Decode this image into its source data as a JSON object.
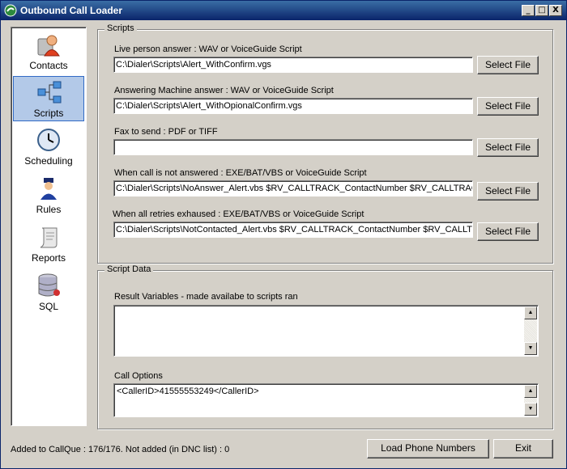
{
  "window": {
    "title": "Outbound Call Loader",
    "minimize_glyph": "_",
    "maximize_glyph": "□",
    "close_glyph": "X"
  },
  "nav": {
    "items": [
      {
        "label": "Contacts",
        "icon": "contacts-icon"
      },
      {
        "label": "Scripts",
        "icon": "scripts-icon",
        "selected": true
      },
      {
        "label": "Scheduling",
        "icon": "clock-icon"
      },
      {
        "label": "Rules",
        "icon": "police-officer-icon"
      },
      {
        "label": "Reports",
        "icon": "scroll-icon"
      },
      {
        "label": "SQL",
        "icon": "database-icon"
      }
    ]
  },
  "scripts": {
    "group_title": "Scripts",
    "select_label": "Select File",
    "fields": [
      {
        "label": "Live person answer : WAV or VoiceGuide Script",
        "value": "C:\\Dialer\\Scripts\\Alert_WithConfirm.vgs"
      },
      {
        "label": "Answering Machine answer : WAV or VoiceGuide Script",
        "value": "C:\\Dialer\\Scripts\\Alert_WithOpionalConfirm.vgs"
      },
      {
        "label": "Fax to send : PDF or TIFF",
        "value": ""
      },
      {
        "label": "When call is not answered : EXE/BAT/VBS or VoiceGuide Script",
        "value": "C:\\Dialer\\Scripts\\NoAnswer_Alert.vbs $RV_CALLTRACK_ContactNumber $RV_CALLTRACK"
      },
      {
        "label": "When all retries exhaused : EXE/BAT/VBS or VoiceGuide Script",
        "value": "C:\\Dialer\\Scripts\\NotContacted_Alert.vbs $RV_CALLTRACK_ContactNumber $RV_CALLTRACK"
      }
    ]
  },
  "script_data": {
    "group_title": "Script Data",
    "result_variables_label": "Result Variables - made availabe to scripts ran",
    "result_variables_value": "",
    "call_options_label": "Call Options",
    "call_options_value": "<CallerID>41555553249</CallerID>"
  },
  "footer": {
    "status": "Added to CallQue : 176/176. Not added (in DNC list) : 0",
    "load_button": "Load Phone Numbers",
    "exit_button": "Exit"
  }
}
